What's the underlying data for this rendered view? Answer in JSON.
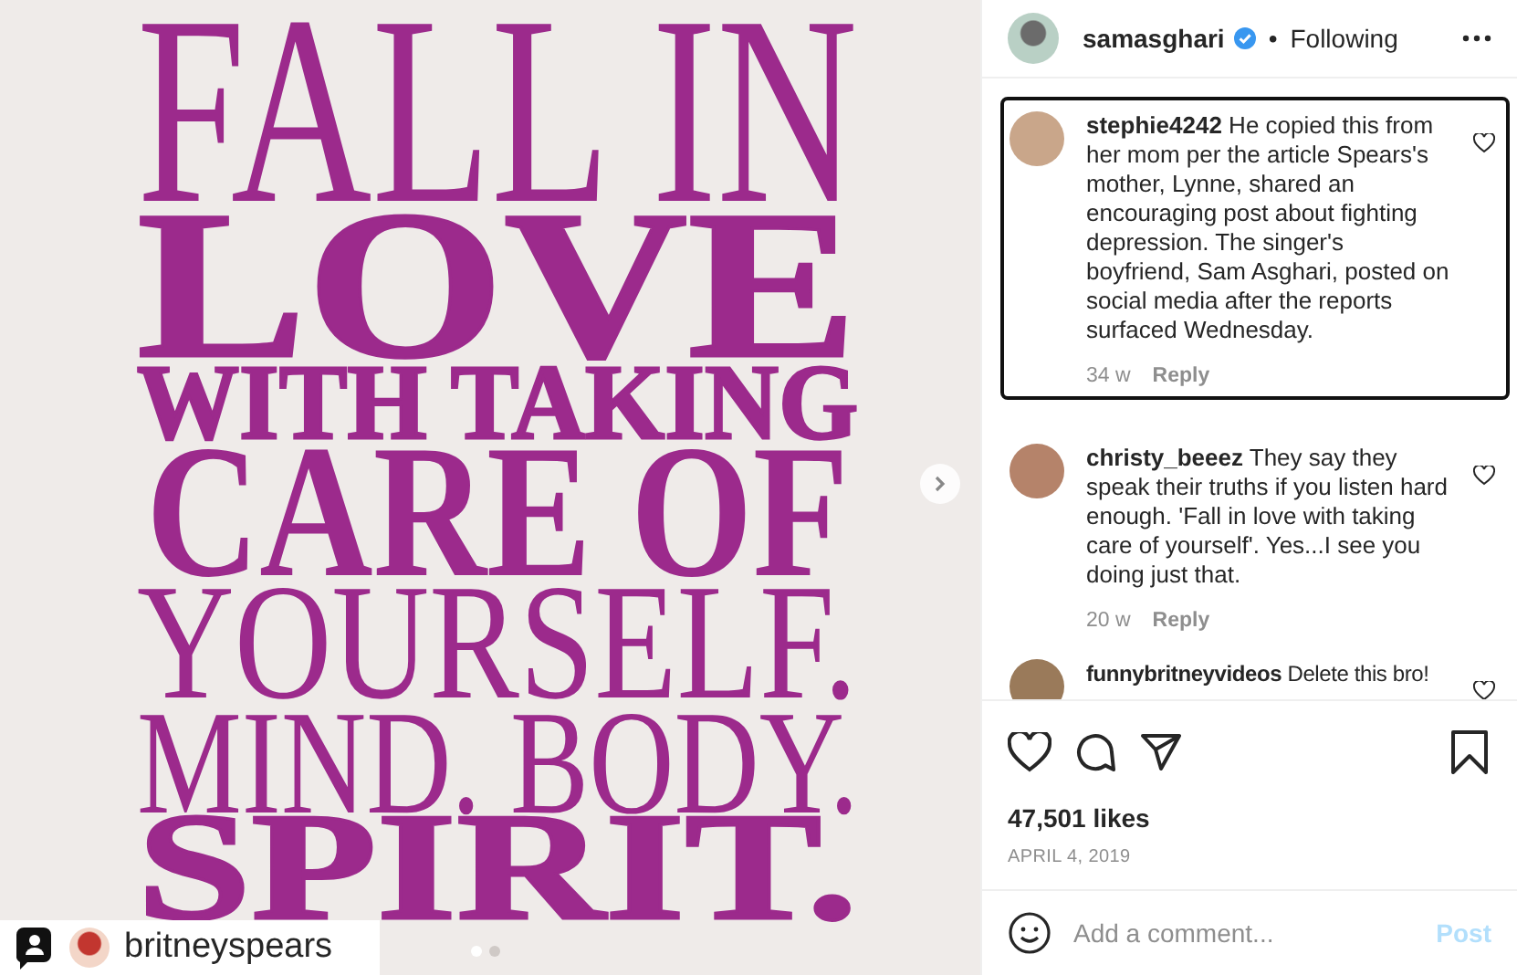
{
  "post": {
    "quote_lines": [
      {
        "text": "FALL IN",
        "kind": "thin"
      },
      {
        "text": "LOVE",
        "kind": "bold"
      },
      {
        "text": "WITH TAKING",
        "kind": "bold"
      },
      {
        "text": "CARE OF",
        "kind": "medium"
      },
      {
        "text": "YOURSELF.",
        "kind": "thin"
      },
      {
        "text": "MIND. BODY.",
        "kind": "thin"
      },
      {
        "text": "SPIRIT.",
        "kind": "bold"
      }
    ],
    "tagged_user": "britneyspears",
    "carousel_dots": [
      {
        "selected": true
      },
      {
        "selected": false
      }
    ]
  },
  "header": {
    "username": "samasghari",
    "verified": true,
    "separator": "•",
    "follow_status": "Following"
  },
  "comments": [
    {
      "username": "stephie4242",
      "text": "He copied this from her mom per the article Spears's mother, Lynne, shared an encouraging post about fighting depression. The singer's boyfriend, Sam Asghari, posted on social media after the reports surfaced Wednesday.",
      "age": "34 w",
      "reply": "Reply",
      "selected": true
    },
    {
      "username": "christy_beeez",
      "text": "They say they speak their truths if you listen hard enough. 'Fall in love with taking care of yourself'. Yes...I see you doing just that.",
      "age": "20 w",
      "reply": "Reply",
      "selected": false
    },
    {
      "username": "funnybritneyvideos",
      "text": "Delete this bro!",
      "selected": false
    }
  ],
  "likes": "47,501 likes",
  "date": "APRIL 4, 2019",
  "add_comment": {
    "placeholder": "Add a comment...",
    "post_button": "Post",
    "disabled": true
  }
}
